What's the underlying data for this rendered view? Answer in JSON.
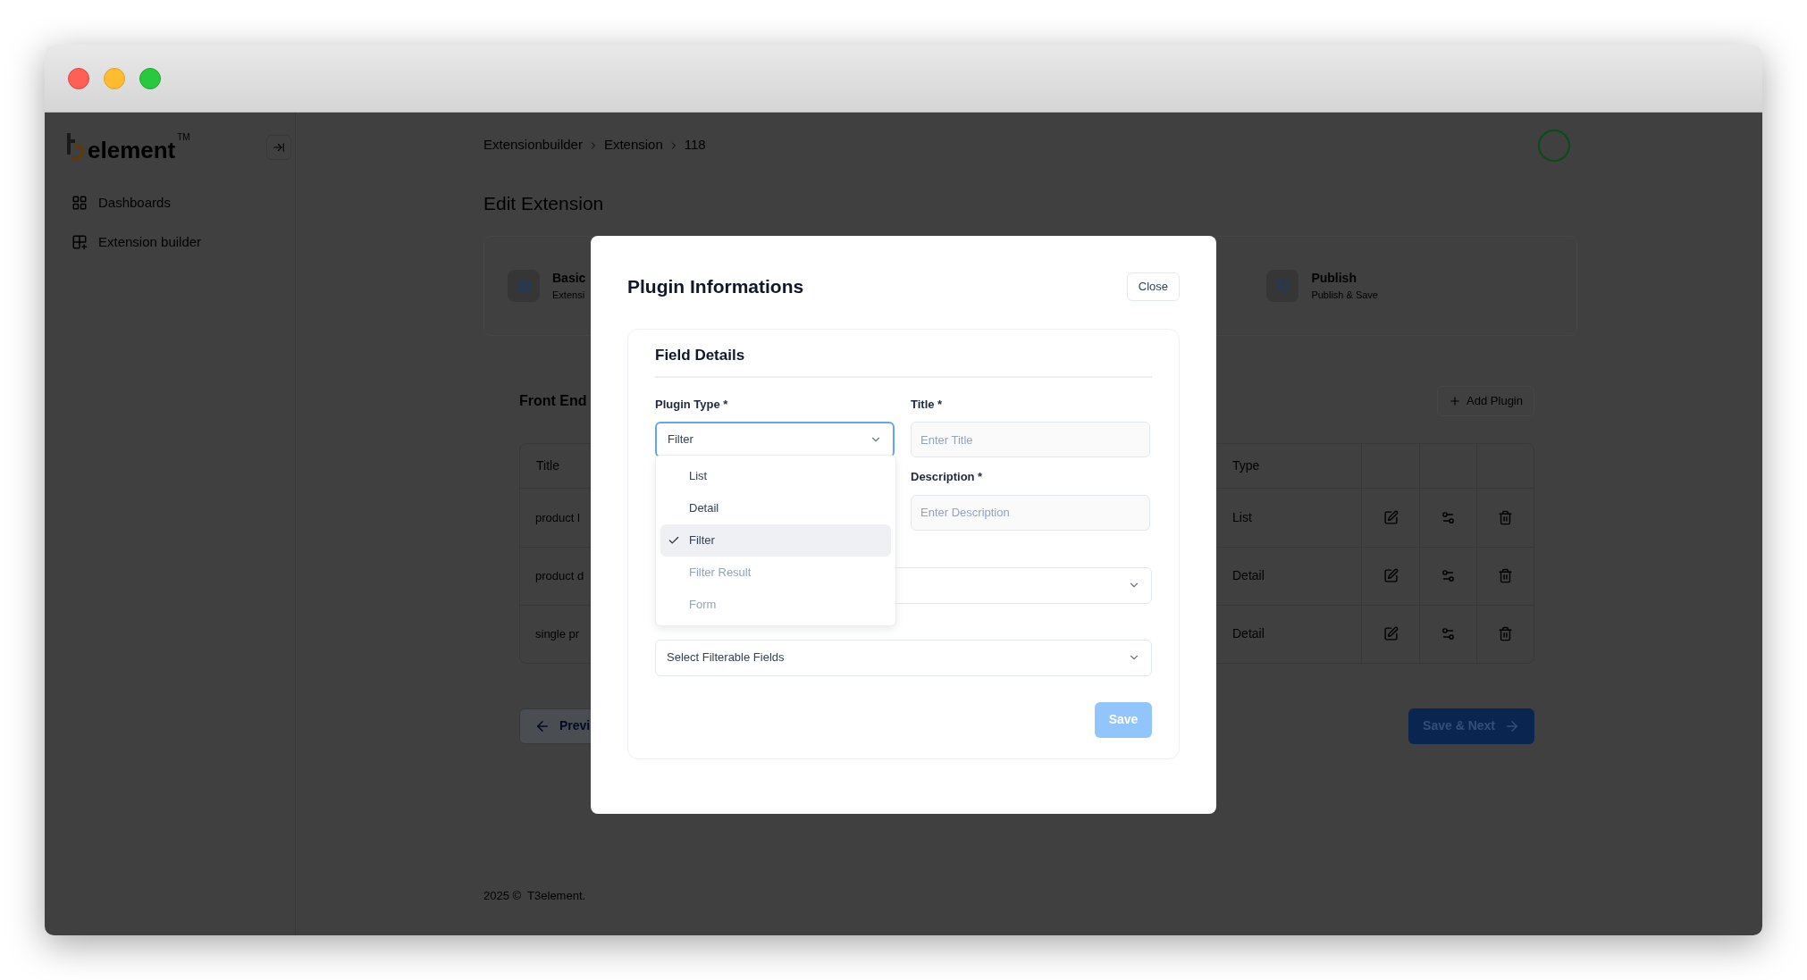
{
  "sidebar": {
    "logo": {
      "text": "element",
      "mark": "TM"
    },
    "items": [
      {
        "label": "Dashboards",
        "selected": false
      },
      {
        "label": "Extension builder",
        "selected": false
      }
    ]
  },
  "breadcrumb": [
    "Extensionbuilder",
    "Extension",
    "118"
  ],
  "page_title": "Edit Extension",
  "steps": [
    {
      "title": "Basic",
      "subtitle": "Extensi",
      "kind": "settings"
    },
    {
      "title": "Publish",
      "subtitle": "Publish & Save",
      "kind": "sliders"
    }
  ],
  "section_title": "Front End",
  "add_button": "Add Plugin",
  "table": {
    "columns": [
      "Title",
      "Type"
    ],
    "rows": [
      {
        "title": "product l",
        "type": "List"
      },
      {
        "title": "product d",
        "type": "Detail"
      },
      {
        "title": "single pr",
        "type": "Detail"
      }
    ]
  },
  "prev_button": "Previ",
  "next_button": "Save & Next",
  "footer": "2025 ©  T3element.",
  "modal": {
    "title": "Plugin Informations",
    "close": "Close",
    "card_title": "Field Details",
    "plugin_type": {
      "label": "Plugin Type *",
      "value": "Filter",
      "focused": true
    },
    "title_field": {
      "label": "Title *",
      "placeholder": "Enter Title"
    },
    "description_field": {
      "label": "Description *",
      "placeholder": "Enter Description"
    },
    "filterable_fields": {
      "placeholder": "Select Filterable Fields"
    },
    "options": [
      {
        "label": "List",
        "selected": false,
        "disabled": false
      },
      {
        "label": "Detail",
        "selected": false,
        "disabled": false
      },
      {
        "label": "Filter",
        "selected": true,
        "disabled": false
      },
      {
        "label": "Filter Result",
        "selected": false,
        "disabled": true
      },
      {
        "label": "Form",
        "selected": false,
        "disabled": true
      }
    ],
    "save": {
      "label": "Save",
      "disabled": true
    }
  }
}
